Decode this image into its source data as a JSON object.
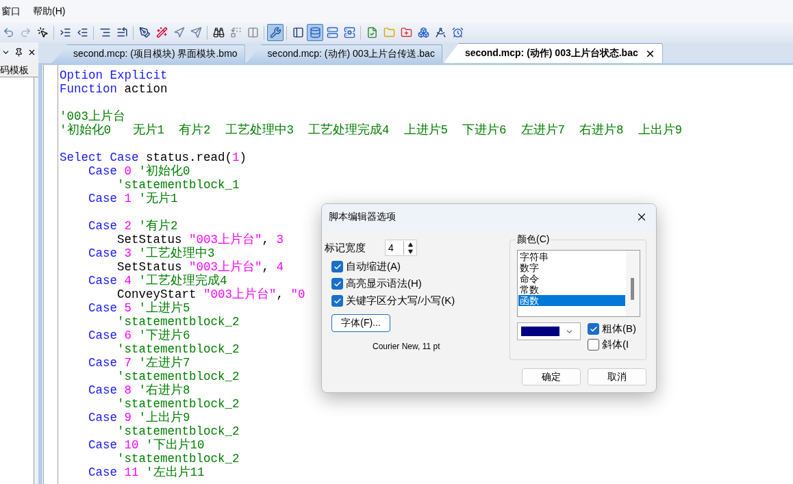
{
  "menu": [
    {
      "label": "窗口"
    },
    {
      "label": "帮助(H)"
    }
  ],
  "toolbar_buttons": [
    {
      "pressed": false
    },
    {
      "pressed": false
    },
    {
      "pressed": false
    },
    {
      "pressed": false
    },
    {
      "pressed": false
    },
    {
      "pressed": false
    },
    {
      "pressed": false
    },
    {
      "pressed": false
    },
    {
      "pressed": false
    },
    {
      "pressed": false
    },
    {
      "pressed": false
    },
    {
      "pressed": false
    },
    {
      "pressed": false
    },
    {
      "pressed": false
    },
    {
      "pressed": true
    },
    {
      "pressed": false
    },
    {
      "pressed": true
    },
    {
      "pressed": false
    },
    {
      "pressed": false
    },
    {
      "pressed": false
    },
    {
      "pressed": false
    },
    {
      "pressed": false
    },
    {
      "pressed": false
    },
    {
      "pressed": false
    },
    {
      "pressed": false
    }
  ],
  "side_panel": {
    "tab": "码模板"
  },
  "tabs": [
    {
      "label": "second.mcp: (项目模块) 界面模块.bmo",
      "selected": false
    },
    {
      "label": "second.mcp: (动作) 003上片台传送.bac",
      "selected": false
    },
    {
      "label": "second.mcp: (动作) 003上片台状态.bac",
      "selected": true
    }
  ],
  "code_lines": [
    {
      "kind": "code",
      "segments": [
        {
          "kind": "keyword",
          "text": "Option Explicit"
        }
      ]
    },
    {
      "kind": "code",
      "segments": [
        {
          "kind": "keyword",
          "text": "Function"
        },
        {
          "kind": "plain",
          "text": " action"
        }
      ]
    },
    {
      "kind": "blank"
    },
    {
      "kind": "code",
      "segments": [
        {
          "kind": "comment",
          "text": "'003上片台"
        }
      ]
    },
    {
      "kind": "code",
      "segments": [
        {
          "kind": "comment",
          "text": "'初始化0   无片1  有片2  工艺处理中3  工艺处理完成4  上进片5  下进片6  左进片7  右进片8  上出片9"
        }
      ]
    },
    {
      "kind": "blank"
    },
    {
      "kind": "code",
      "segments": [
        {
          "kind": "keyword",
          "text": "Select Case"
        },
        {
          "kind": "plain",
          "text": " status.read("
        },
        {
          "kind": "number",
          "text": "1"
        },
        {
          "kind": "plain",
          "text": ")"
        }
      ]
    },
    {
      "kind": "code",
      "segments": [
        {
          "kind": "keyword",
          "text": "    Case"
        },
        {
          "kind": "number",
          "text": " 0"
        },
        {
          "kind": "comment",
          "text": " '初始化0"
        }
      ]
    },
    {
      "kind": "code",
      "segments": [
        {
          "kind": "comment",
          "text": "        'statementblock_1"
        }
      ]
    },
    {
      "kind": "code",
      "segments": [
        {
          "kind": "keyword",
          "text": "    Case"
        },
        {
          "kind": "number",
          "text": " 1"
        },
        {
          "kind": "comment",
          "text": " '无片1"
        }
      ]
    },
    {
      "kind": "blank"
    },
    {
      "kind": "code",
      "segments": [
        {
          "kind": "keyword",
          "text": "    Case"
        },
        {
          "kind": "number",
          "text": " 2"
        },
        {
          "kind": "comment",
          "text": " '有片2"
        }
      ]
    },
    {
      "kind": "code",
      "segments": [
        {
          "kind": "plain",
          "text": "        SetStatus "
        },
        {
          "kind": "string",
          "text": "\"003上片台\""
        },
        {
          "kind": "plain",
          "text": ", "
        },
        {
          "kind": "number",
          "text": "3"
        }
      ]
    },
    {
      "kind": "code",
      "segments": [
        {
          "kind": "keyword",
          "text": "    Case"
        },
        {
          "kind": "number",
          "text": " 3"
        },
        {
          "kind": "comment",
          "text": " '工艺处理中3"
        }
      ]
    },
    {
      "kind": "code",
      "segments": [
        {
          "kind": "plain",
          "text": "        SetStatus "
        },
        {
          "kind": "string",
          "text": "\"003上片台\""
        },
        {
          "kind": "plain",
          "text": ", "
        },
        {
          "kind": "number",
          "text": "4"
        }
      ]
    },
    {
      "kind": "code",
      "segments": [
        {
          "kind": "keyword",
          "text": "    Case"
        },
        {
          "kind": "number",
          "text": " 4"
        },
        {
          "kind": "comment",
          "text": " '工艺处理完成4"
        }
      ]
    },
    {
      "kind": "code",
      "segments": [
        {
          "kind": "plain",
          "text": "        ConveyStart "
        },
        {
          "kind": "string",
          "text": "\"003上片台\""
        },
        {
          "kind": "plain",
          "text": ", "
        },
        {
          "kind": "string",
          "text": "\"0"
        }
      ]
    },
    {
      "kind": "code",
      "segments": [
        {
          "kind": "keyword",
          "text": "    Case"
        },
        {
          "kind": "number",
          "text": " 5"
        },
        {
          "kind": "comment",
          "text": " '上进片5"
        }
      ]
    },
    {
      "kind": "code",
      "segments": [
        {
          "kind": "comment",
          "text": "        'statementblock_2"
        }
      ]
    },
    {
      "kind": "code",
      "segments": [
        {
          "kind": "keyword",
          "text": "    Case"
        },
        {
          "kind": "number",
          "text": " 6"
        },
        {
          "kind": "comment",
          "text": " '下进片6"
        }
      ]
    },
    {
      "kind": "code",
      "segments": [
        {
          "kind": "comment",
          "text": "        'statementblock_2"
        }
      ]
    },
    {
      "kind": "code",
      "segments": [
        {
          "kind": "keyword",
          "text": "    Case"
        },
        {
          "kind": "number",
          "text": " 7"
        },
        {
          "kind": "comment",
          "text": " '左进片7"
        }
      ]
    },
    {
      "kind": "code",
      "segments": [
        {
          "kind": "comment",
          "text": "        'statementblock_2"
        }
      ]
    },
    {
      "kind": "code",
      "segments": [
        {
          "kind": "keyword",
          "text": "    Case"
        },
        {
          "kind": "number",
          "text": " 8"
        },
        {
          "kind": "comment",
          "text": " '右进片8"
        }
      ]
    },
    {
      "kind": "code",
      "segments": [
        {
          "kind": "comment",
          "text": "        'statementblock_2"
        }
      ]
    },
    {
      "kind": "code",
      "segments": [
        {
          "kind": "keyword",
          "text": "    Case"
        },
        {
          "kind": "number",
          "text": " 9"
        },
        {
          "kind": "comment",
          "text": " '上出片9"
        }
      ]
    },
    {
      "kind": "code",
      "segments": [
        {
          "kind": "comment",
          "text": "        'statementblock_2"
        }
      ]
    },
    {
      "kind": "code",
      "segments": [
        {
          "kind": "keyword",
          "text": "    Case"
        },
        {
          "kind": "number",
          "text": " 10"
        },
        {
          "kind": "comment",
          "text": " '下出片10"
        }
      ]
    },
    {
      "kind": "code",
      "segments": [
        {
          "kind": "comment",
          "text": "        'statementblock_2"
        }
      ]
    },
    {
      "kind": "code",
      "segments": [
        {
          "kind": "keyword",
          "text": "    Case"
        },
        {
          "kind": "number",
          "text": " 11"
        },
        {
          "kind": "comment",
          "text": " '左出片11"
        }
      ]
    }
  ],
  "dialog": {
    "title": "脚本编辑器选项",
    "tab_width": {
      "label": "标记宽度",
      "value": "4"
    },
    "options": [
      {
        "label": "自动缩进(A)",
        "checked": true
      },
      {
        "label": "高亮显示语法(H)",
        "checked": true
      },
      {
        "label": "关键字区分大写/小写(K)",
        "checked": true
      }
    ],
    "font_button": "字体(F)...",
    "font_info": "Courier New, 11 pt",
    "color_group": {
      "title": "颜色(C)",
      "items": [
        {
          "label": "字符串",
          "selected": false
        },
        {
          "label": "数字",
          "selected": false
        },
        {
          "label": "命令",
          "selected": false
        },
        {
          "label": "常数",
          "selected": false
        },
        {
          "label": "函数",
          "selected": true
        }
      ],
      "swatch": {
        "color": "#000080"
      },
      "styles": [
        {
          "label": "粗体(B)",
          "checked": true
        },
        {
          "label": "斜体(I",
          "checked": false
        }
      ]
    },
    "buttons": [
      {
        "label": "确定"
      },
      {
        "label": "取消"
      }
    ]
  }
}
